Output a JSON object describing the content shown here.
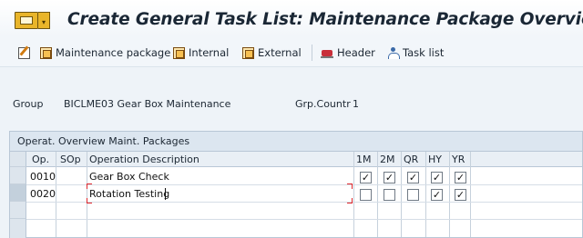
{
  "window": {
    "title": "Create General Task List: Maintenance Package Overview",
    "menu_icon": "sap-menu-icon",
    "menu_dropdown": "▾"
  },
  "toolbar": {
    "edit_icon": "edit-icon",
    "maintenance_package": "Maintenance package",
    "internal": "Internal",
    "external": "External",
    "header": "Header",
    "task_list": "Task list"
  },
  "header_fields": {
    "group_label": "Group",
    "group_value": "BICLME03 Gear Box Maintenance",
    "grp_countr_label": "Grp.Countr",
    "grp_countr_value": "1"
  },
  "table": {
    "title": "Operat. Overview Maint. Packages",
    "columns": {
      "op": "Op.",
      "sop": "SOp",
      "description": "Operation Description",
      "p1": "1M",
      "p2": "2M",
      "p3": "QR",
      "p4": "HY",
      "p5": "YR"
    },
    "rows": [
      {
        "op": "0010",
        "sop": "",
        "description": "Gear Box Check",
        "packages": [
          true,
          true,
          true,
          true,
          true
        ]
      },
      {
        "op": "0020",
        "sop": "",
        "description": "Rotation Testing",
        "packages": [
          false,
          false,
          false,
          true,
          true
        ]
      }
    ],
    "check_mark": "✓"
  }
}
